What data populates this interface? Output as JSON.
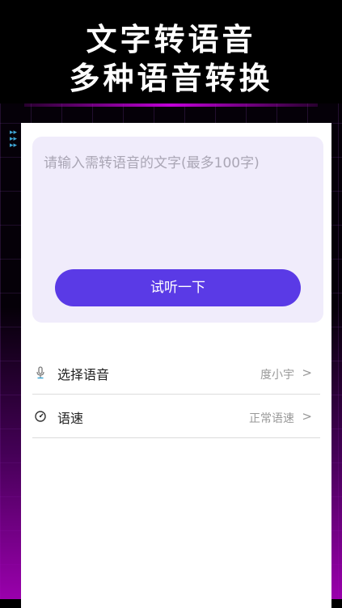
{
  "header": {
    "title_line1": "文字转语音",
    "title_line2": "多种语音转换"
  },
  "input": {
    "placeholder": "请输入需转语音的文字(最多100字)"
  },
  "try_button": {
    "label": "试听一下"
  },
  "settings": [
    {
      "label": "选择语音",
      "value": "度小宇",
      "icon": "microphone-icon"
    },
    {
      "label": "语速",
      "value": "正常语速",
      "icon": "speedometer-icon"
    }
  ],
  "colors": {
    "accent": "#5a3ae6",
    "input_bg": "#f0ecfb",
    "neon": "#c100d8"
  }
}
